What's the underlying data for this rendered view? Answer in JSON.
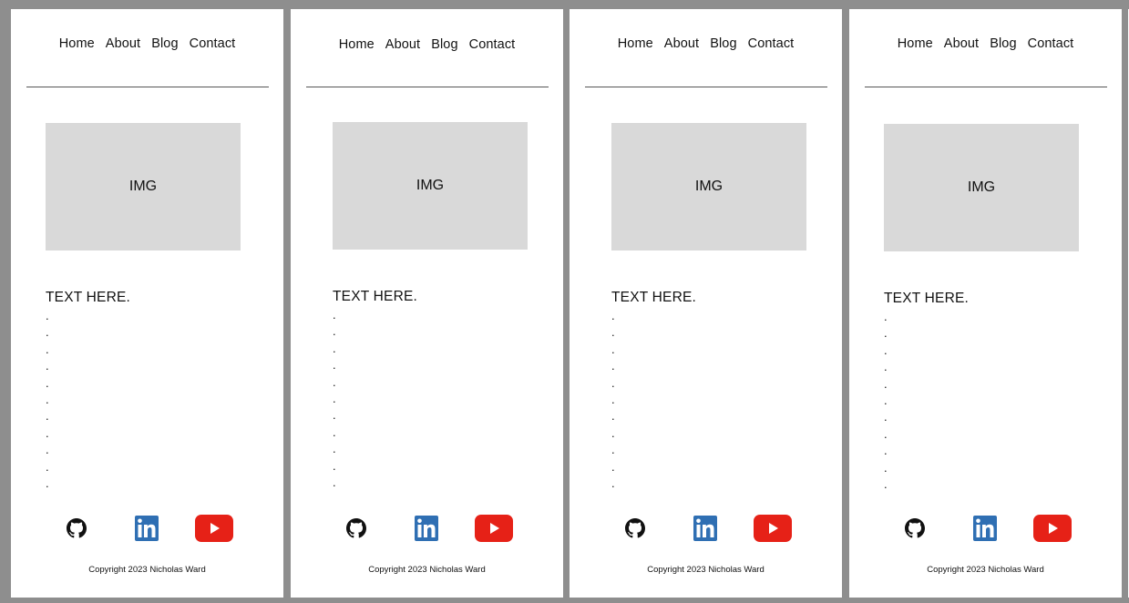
{
  "frames": [
    {
      "nav": [
        "Home",
        "About",
        "Blog",
        "Contact"
      ],
      "image_label": "IMG",
      "text_heading": "TEXT HERE.",
      "dots": [
        ".",
        ".",
        ".",
        ".",
        ".",
        ".",
        ".",
        ".",
        ".",
        ".",
        "."
      ],
      "copyright": "Copyright 2023 Nicholas Ward"
    },
    {
      "nav": [
        "Home",
        "About",
        "Blog",
        "Contact"
      ],
      "image_label": "IMG",
      "text_heading": "TEXT HERE.",
      "dots": [
        ".",
        ".",
        ".",
        ".",
        ".",
        ".",
        ".",
        ".",
        ".",
        ".",
        "."
      ],
      "copyright": "Copyright 2023 Nicholas Ward"
    },
    {
      "nav": [
        "Home",
        "About",
        "Blog",
        "Contact"
      ],
      "image_label": "IMG",
      "text_heading": "TEXT HERE.",
      "dots": [
        ".",
        ".",
        ".",
        ".",
        ".",
        ".",
        ".",
        ".",
        ".",
        ".",
        "."
      ],
      "copyright": "Copyright 2023 Nicholas Ward"
    },
    {
      "nav": [
        "Home",
        "About",
        "Blog",
        "Contact"
      ],
      "image_label": "IMG",
      "text_heading": "TEXT HERE.",
      "dots": [
        ".",
        ".",
        ".",
        ".",
        ".",
        ".",
        ".",
        ".",
        ".",
        ".",
        "."
      ],
      "copyright": "Copyright 2023 Nicholas Ward"
    }
  ],
  "icons": {
    "github": "github-icon",
    "linkedin": "linkedin-icon",
    "youtube": "youtube-icon"
  },
  "colors": {
    "canvas_bg": "#8e8e8e",
    "frame_bg": "#ffffff",
    "image_placeholder": "#d9d9d9",
    "linkedin_blue": "#2f6fb3",
    "youtube_red": "#e62117",
    "text": "#111111"
  }
}
